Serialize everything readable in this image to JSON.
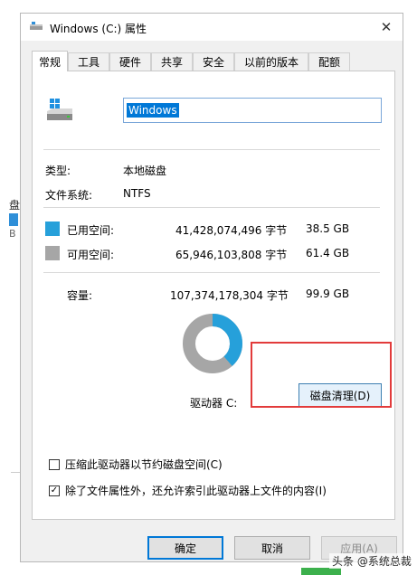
{
  "background": {
    "text1": "盘",
    "text2": "B"
  },
  "window": {
    "title": "Windows (C:) 属性",
    "close_glyph": "✕"
  },
  "tabs": [
    {
      "label": "常规",
      "active": true
    },
    {
      "label": "工具"
    },
    {
      "label": "硬件"
    },
    {
      "label": "共享"
    },
    {
      "label": "安全"
    },
    {
      "label": "以前的版本"
    },
    {
      "label": "配额"
    }
  ],
  "general": {
    "drive_name": "Windows",
    "type_label": "类型:",
    "type_value": "本地磁盘",
    "fs_label": "文件系统:",
    "fs_value": "NTFS",
    "used": {
      "label": "已用空间:",
      "bytes": "41,428,074,496 字节",
      "size": "38.5 GB",
      "color": "#26a0da"
    },
    "free": {
      "label": "可用空间:",
      "bytes": "65,946,103,808 字节",
      "size": "61.4 GB",
      "color": "#a6a6a6"
    },
    "capacity": {
      "label": "容量:",
      "bytes": "107,374,178,304 字节",
      "size": "99.9 GB"
    },
    "used_fraction": 0.385,
    "drive_label": "驱动器 C:",
    "cleanup_button": "磁盘清理(D)",
    "compress_label": "压缩此驱动器以节约磁盘空间(C)",
    "compress_checked": false,
    "index_label": "除了文件属性外，还允许索引此驱动器上文件的内容(I)",
    "index_checked": true,
    "check_glyph": "✓"
  },
  "buttons": {
    "ok": "确定",
    "cancel": "取消",
    "apply": "应用(A)"
  },
  "watermark": "头条 @系统总裁",
  "highlight_color": "#e23b3b"
}
